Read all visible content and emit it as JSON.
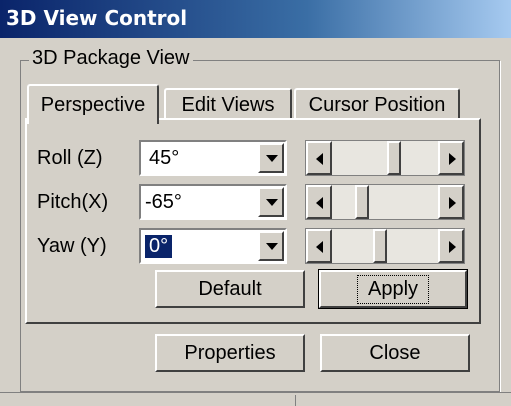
{
  "window": {
    "title": "3D View Control"
  },
  "group": {
    "label": "3D Package View"
  },
  "tabs": [
    {
      "label": "Perspective",
      "active": true
    },
    {
      "label": "Edit Views",
      "active": false
    },
    {
      "label": "Cursor Position",
      "active": false
    }
  ],
  "controls": {
    "roll": {
      "label": "Roll (Z)",
      "value": "45°",
      "slider_position": 0.6
    },
    "pitch": {
      "label": "Pitch(X)",
      "value": "-65°",
      "slider_position": 0.25
    },
    "yaw": {
      "label": "Yaw  (Y)",
      "value": "0°",
      "slider_position": 0.45
    }
  },
  "buttons": {
    "default": "Default",
    "apply": "Apply",
    "properties": "Properties",
    "close": "Close"
  },
  "colors": {
    "face": "#d4d0c8",
    "title_start": "#0a246a",
    "title_end": "#a6caf0"
  }
}
